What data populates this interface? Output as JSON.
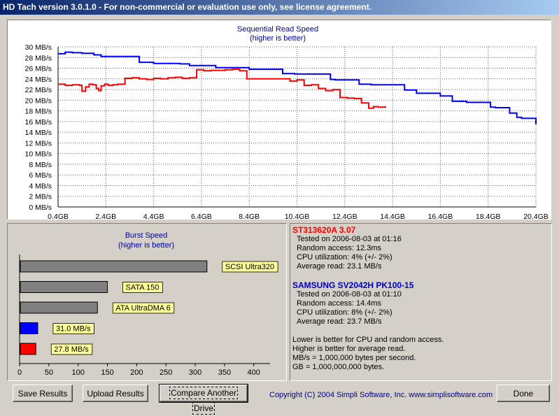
{
  "window": {
    "title": "HD Tach version 3.0.1.0  - For non-commercial or evaluation use only, see license agreement."
  },
  "seq_chart": {
    "title_line1": "Sequential Read Speed",
    "title_line2": "(higher is better)"
  },
  "burst_chart": {
    "title_line1": "Burst Speed",
    "title_line2": "(higher is better)"
  },
  "colors": {
    "drive1": "#ff0000",
    "drive2": "#0000ff",
    "gray_bar": "#808080",
    "label_bg": "#ffff99"
  },
  "drive1": {
    "name": "ST313620A 3.07",
    "tested": "Tested on 2006-08-03 at 01:16",
    "random_access": "Random access: 12.3ms",
    "cpu": "CPU utilization: 4% (+/- 2%)",
    "average": "Average read: 23.1 MB/s"
  },
  "drive2": {
    "name": "SAMSUNG SV2042H PK100-15",
    "tested": "Tested on 2006-08-03 at 01:10",
    "random_access": "Random access: 14.4ms",
    "cpu": "CPU utilization: 8% (+/- 2%)",
    "average": "Average read: 23.7 MB/s"
  },
  "notes": {
    "line1": "Lower is better for CPU and random access.",
    "line2": "Higher is better for average read.",
    "line3": "MB/s = 1,000,000 bytes per second.",
    "line4": "GB = 1,000,000,000 bytes."
  },
  "buttons": {
    "save": "Save Results",
    "upload": "Upload Results",
    "compare": "Compare Another Drive",
    "done": "Done"
  },
  "footer": {
    "copyright": "Copyright (C) 2004 Simpli Software, Inc. www.simplisoftware.com"
  },
  "chart_data": [
    {
      "type": "line",
      "title": "Sequential Read Speed",
      "subtitle": "(higher is better)",
      "y_ticks": [
        "0 MB/s",
        "2 MB/s",
        "4 MB/s",
        "6 MB/s",
        "8 MB/s",
        "10 MB/s",
        "12 MB/s",
        "14 MB/s",
        "16 MB/s",
        "18 MB/s",
        "20 MB/s",
        "22 MB/s",
        "24 MB/s",
        "26 MB/s",
        "28 MB/s",
        "30 MB/s"
      ],
      "x_ticks": [
        "0,4GB",
        "2,4GB",
        "4,4GB",
        "6,4GB",
        "8,4GB",
        "10,4GB",
        "12,4GB",
        "14,4GB",
        "16,4GB",
        "18,4GB",
        "20,4GB"
      ],
      "xlim": [
        0.4,
        20.4
      ],
      "ylim": [
        0,
        30
      ],
      "grid": true,
      "series": [
        {
          "color": "#0000ff",
          "x": [
            0.4,
            0.7,
            1.0,
            1.4,
            1.9,
            2.2,
            3.8,
            4.4,
            5.5,
            5.9,
            7.0,
            8.4,
            9.8,
            10.3,
            11.8,
            12.0,
            13.0,
            13.5,
            14.9,
            15.4,
            16.4,
            16.9,
            17.5,
            18.5,
            18.7,
            19.3,
            19.6,
            19.8,
            20.4
          ],
          "y": [
            28.7,
            29.0,
            28.9,
            28.8,
            28.5,
            28.2,
            27.1,
            26.9,
            26.8,
            26.5,
            26.1,
            25.8,
            25.0,
            24.9,
            23.9,
            23.8,
            23.0,
            22.9,
            21.9,
            21.3,
            20.8,
            19.8,
            19.6,
            18.7,
            18.6,
            17.6,
            16.8,
            16.6,
            15.5
          ]
        },
        {
          "color": "#ff0000",
          "x": [
            0.4,
            0.7,
            1.0,
            1.3,
            1.4,
            1.55,
            1.7,
            1.85,
            2.0,
            2.1,
            2.2,
            2.35,
            2.5,
            2.7,
            2.9,
            3.2,
            3.5,
            3.8,
            4.1,
            4.4,
            4.7,
            5.0,
            5.3,
            5.6,
            5.9,
            6.2,
            6.5,
            6.8,
            7.1,
            7.4,
            7.7,
            8.0,
            8.3,
            8.6,
            8.9,
            9.2,
            9.5,
            9.8,
            10.1,
            10.4,
            10.7,
            11.0,
            11.3,
            11.6,
            11.9,
            12.2,
            12.5,
            12.8,
            13.1,
            13.4,
            13.6,
            13.8,
            14.1
          ],
          "y": [
            23.0,
            22.8,
            22.9,
            22.8,
            21.7,
            22.5,
            23.0,
            22.9,
            22.2,
            21.8,
            22.7,
            23.0,
            22.8,
            22.9,
            23.0,
            24.1,
            24.2,
            24.0,
            23.9,
            24.1,
            24.0,
            24.2,
            24.3,
            24.1,
            24.2,
            25.7,
            25.5,
            25.6,
            25.6,
            25.7,
            25.8,
            25.5,
            24.0,
            24.0,
            24.0,
            24.0,
            24.0,
            24.0,
            23.6,
            23.8,
            22.8,
            22.9,
            22.2,
            21.8,
            22.0,
            20.5,
            20.4,
            20.3,
            19.5,
            18.5,
            18.8,
            18.7,
            18.9
          ]
        }
      ]
    },
    {
      "type": "bar",
      "orientation": "horizontal",
      "title": "Burst Speed",
      "subtitle": "(higher is better)",
      "x_ticks": [
        "0",
        "50",
        "100",
        "150",
        "200",
        "250",
        "300",
        "350",
        "400"
      ],
      "xlim": [
        0,
        420
      ],
      "bars": [
        {
          "label": "SCSI Ultra320",
          "value": 320,
          "color": "#808080"
        },
        {
          "label": "SATA 150",
          "value": 150,
          "color": "#808080"
        },
        {
          "label": "ATA UltraDMA 6",
          "value": 133,
          "color": "#808080"
        },
        {
          "label": "31.0 MB/s",
          "value": 31.0,
          "color": "#0000ff"
        },
        {
          "label": "27.8 MB/s",
          "value": 27.8,
          "color": "#ff0000"
        }
      ]
    }
  ]
}
